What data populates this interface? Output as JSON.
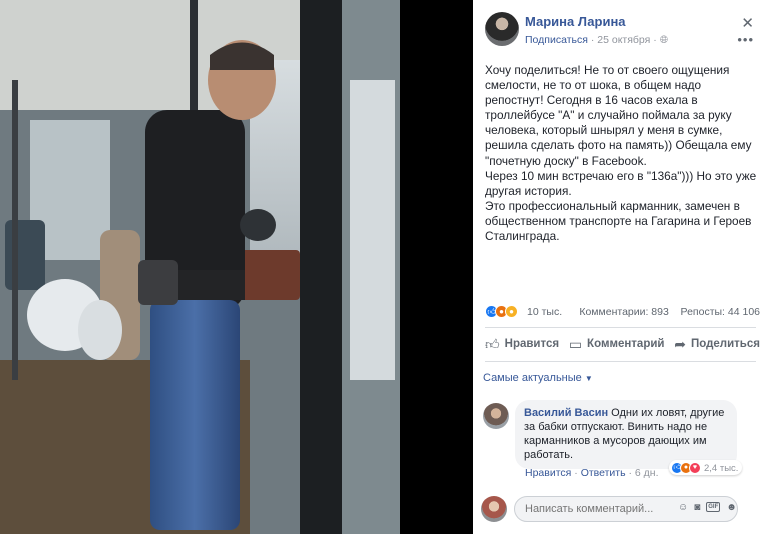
{
  "post": {
    "author": "Марина Ларина",
    "subscribe": "Подписаться",
    "date": "25 октября",
    "privacy_icon": "globe-icon",
    "text_lines": [
      "Хочу поделиться! Не то от своего ощущения смелости, не то от шока, в общем надо репостнут! Сегодня в 16 часов ехала в троллейбусе \"А\" и случайно поймала за руку человека, который шнырял у меня в сумке, решила сделать фото на память)) Обещала ему \"почетную доску\" в Facebook.",
      "Через 10 мин встречаю его в \"136а\"))) Но это уже другая история.",
      "Это профессиональный карманник, замечен в общественном транспорте на Гагарина и Героев Сталинграда."
    ]
  },
  "stats": {
    "reactions_count": "10 тыс.",
    "comments": "Комментарии: 893",
    "reposts": "Репосты: 44 106"
  },
  "actions": {
    "like": "Нравится",
    "comment": "Комментарий",
    "share": "Поделиться"
  },
  "comments_sort": "Самые актуальные",
  "comment": {
    "author": "Василий Васин",
    "text": "Одни их ловят, другие за бабки отпускают. Винить надо не карманников а мусоров дающих им работать.",
    "like_link": "Нравится",
    "reply_link": "Ответить",
    "age": "6 дн.",
    "reactions_count": "2,4 тыс."
  },
  "composer": {
    "placeholder": "Написать комментарий..."
  },
  "colors": {
    "link_blue": "#385898",
    "like_blue": "#1877f2"
  }
}
